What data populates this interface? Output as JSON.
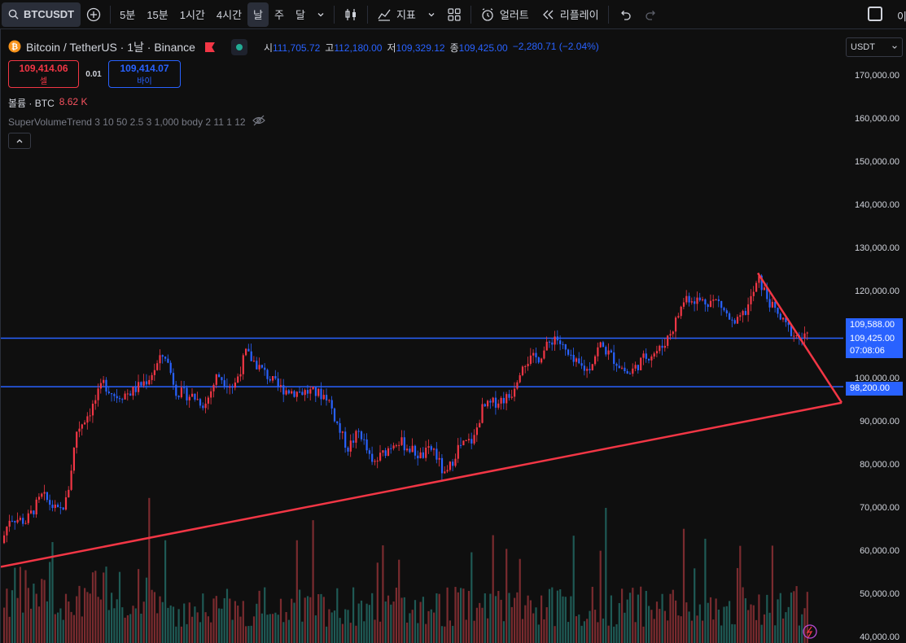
{
  "toolbar": {
    "symbol": "BTCUSDT",
    "intervals": [
      "5분",
      "15분",
      "1시간",
      "4시간",
      "날",
      "주",
      "달"
    ],
    "active_interval": "날",
    "indicators_label": "지표",
    "alert_label": "얼러트",
    "replay_label": "리플레이",
    "right_text": "이"
  },
  "legend": {
    "title": "Bitcoin / TetherUS · 1날 · Binance",
    "open_label": "시",
    "open": "111,705.72",
    "high_label": "고",
    "high": "112,180.00",
    "low_label": "저",
    "low": "109,329.12",
    "close_label": "종",
    "close": "109,425.00",
    "change": "−2,280.71 (−2.04%)"
  },
  "trade": {
    "sell_price": "109,414.06",
    "sell_label": "셀",
    "spread": "0.01",
    "buy_price": "109,414.07",
    "buy_label": "바이"
  },
  "volume": {
    "label": "볼륨 · BTC",
    "value": "8.62 K"
  },
  "indicator": {
    "label": "SuperVolumeTrend 3 10 50 2.5 3 1,000 body 2 11 1 12"
  },
  "axis": {
    "currency": "USDT",
    "ticks": [
      "170,000.00",
      "160,000.00",
      "150,000.00",
      "140,000.00",
      "130,000.00",
      "120,000.00",
      "110,000.00",
      "100,000.00",
      "90,000.00",
      "80,000.00",
      "70,000.00",
      "60,000.00",
      "50,000.00",
      "40,000.00"
    ],
    "tags": {
      "high_tag": "109,588.00",
      "last_price": "109,425.00",
      "countdown": "07:08:06",
      "support": "98,200.00"
    }
  },
  "colors": {
    "up": "#f23645",
    "down": "#2962ff",
    "vol_up": "#7a2b2f",
    "vol_down": "#1f5a55",
    "trend": "#f23645",
    "hline": "#2962ff"
  }
}
